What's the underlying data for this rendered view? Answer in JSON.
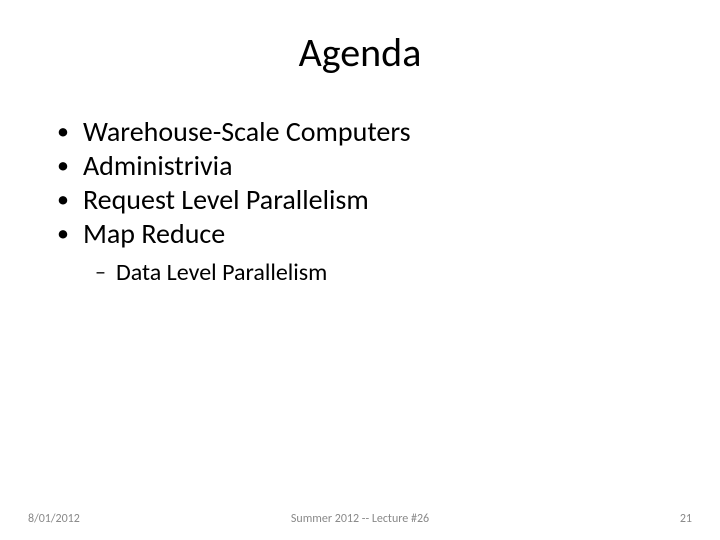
{
  "title": "Agenda",
  "bullets": {
    "b0": "Warehouse-Scale Computers",
    "b1": "Administrivia",
    "b2": "Request Level Parallelism",
    "b3": "Map Reduce"
  },
  "sub_bullets": {
    "s0": "Data Level Parallelism"
  },
  "footer": {
    "date": "8/01/2012",
    "center": "Summer 2012 -- Lecture #26",
    "page": "21"
  }
}
